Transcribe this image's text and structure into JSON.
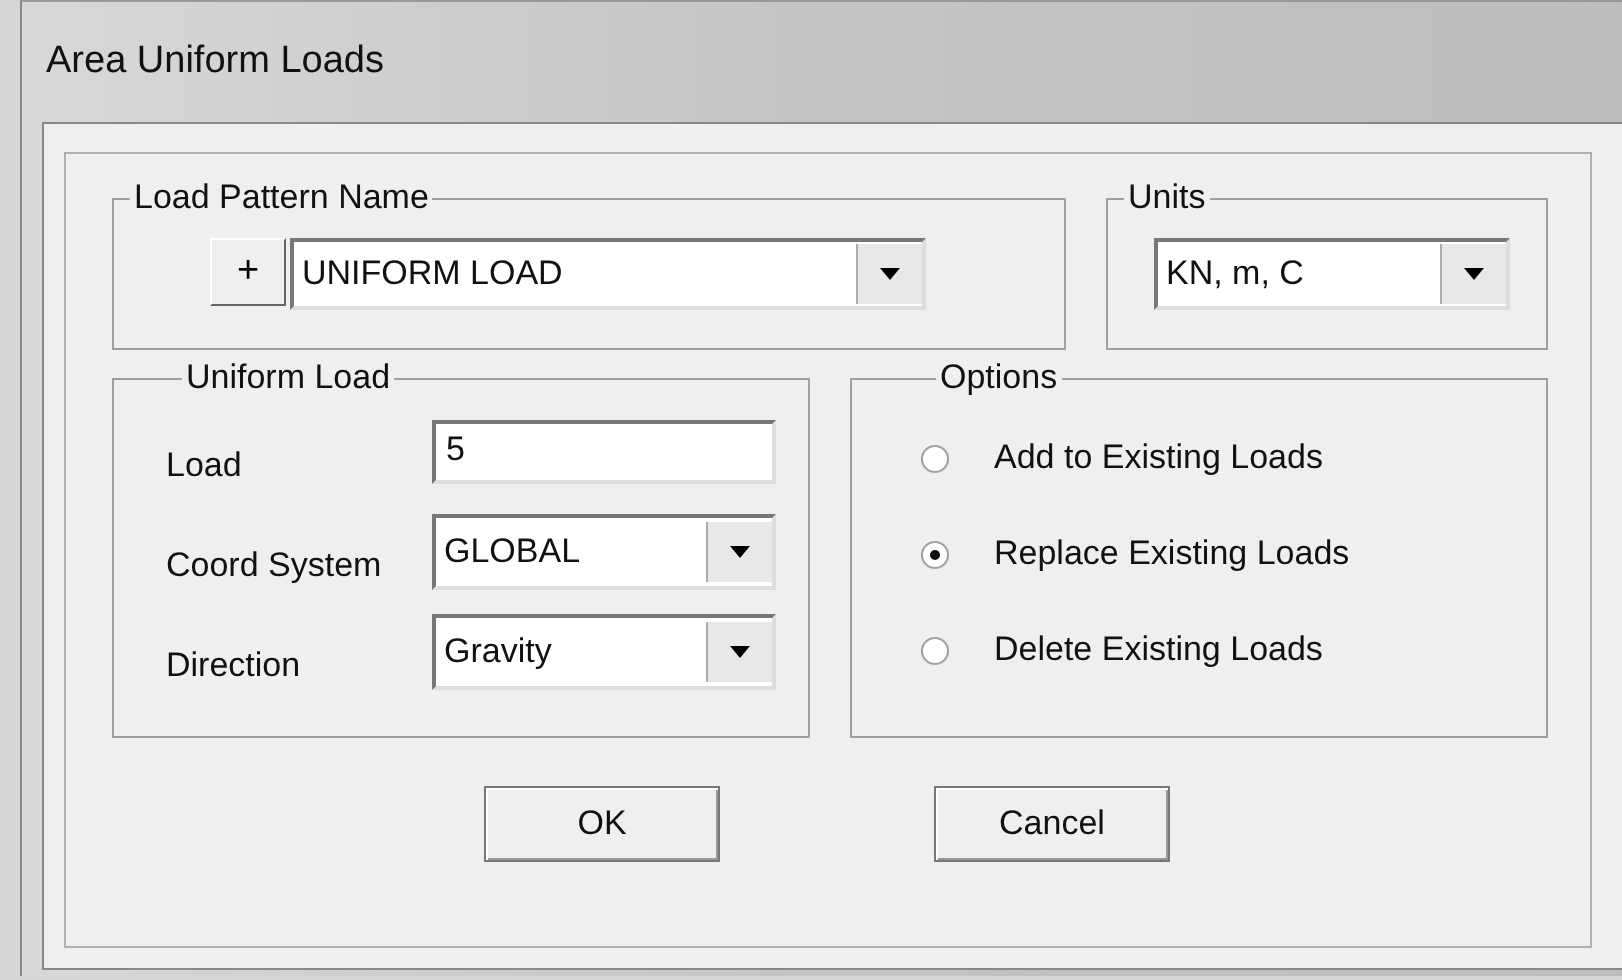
{
  "window": {
    "title": "Area Uniform Loads"
  },
  "load_pattern_name": {
    "title": "Load Pattern Name",
    "add_button": "+",
    "value": "UNIFORM LOAD"
  },
  "units": {
    "title": "Units",
    "value": "KN, m, C"
  },
  "uniform_load": {
    "title": "Uniform Load",
    "fields": [
      {
        "kind": "text",
        "label": "Load",
        "value": "5"
      },
      {
        "kind": "dropdown",
        "label": "Coord System",
        "value": "GLOBAL"
      },
      {
        "kind": "dropdown",
        "label": "Direction",
        "value": "Gravity"
      }
    ]
  },
  "options": {
    "title": "Options",
    "items": [
      {
        "label": "Add to Existing Loads",
        "selected": false
      },
      {
        "label": "Replace Existing Loads",
        "selected": true
      },
      {
        "label": "Delete Existing Loads",
        "selected": false
      }
    ]
  },
  "buttons": [
    "OK",
    "Cancel"
  ]
}
